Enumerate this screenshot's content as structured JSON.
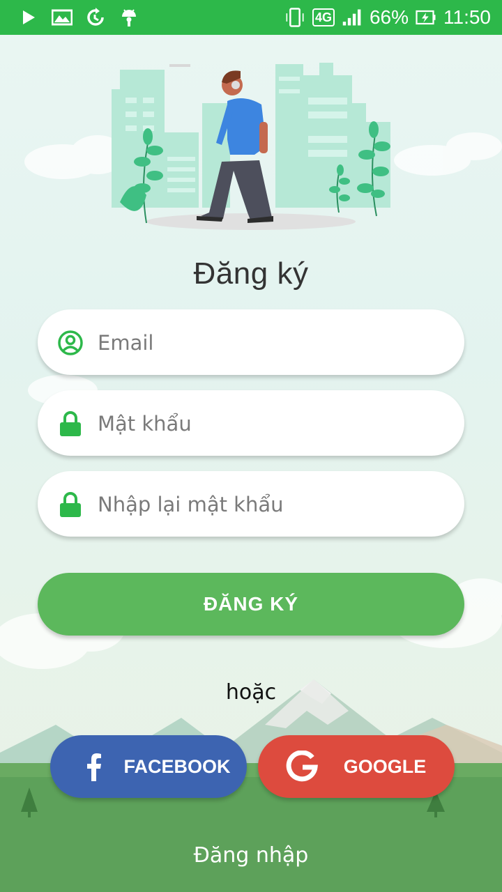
{
  "status_bar": {
    "battery": "66%",
    "time": "11:50",
    "network": "4G"
  },
  "colors": {
    "status_bar": "#2db84a",
    "accent_green": "#5cb85c",
    "facebook": "#3d64b1",
    "google": "#dd4b3e"
  },
  "page": {
    "title": "Đăng ký"
  },
  "form": {
    "email": {
      "placeholder": "Email",
      "value": "",
      "icon": "user-circle-icon"
    },
    "password": {
      "placeholder": "Mật khẩu",
      "value": "",
      "icon": "lock-icon"
    },
    "confirm_password": {
      "placeholder": "Nhập lại mật khẩu",
      "value": "",
      "icon": "lock-icon"
    },
    "submit_label": "ĐĂNG KÝ"
  },
  "or_text": "hoặc",
  "social": {
    "facebook_label": "FACEBOOK",
    "google_label": "GOOGLE"
  },
  "login_link": "Đăng nhập"
}
